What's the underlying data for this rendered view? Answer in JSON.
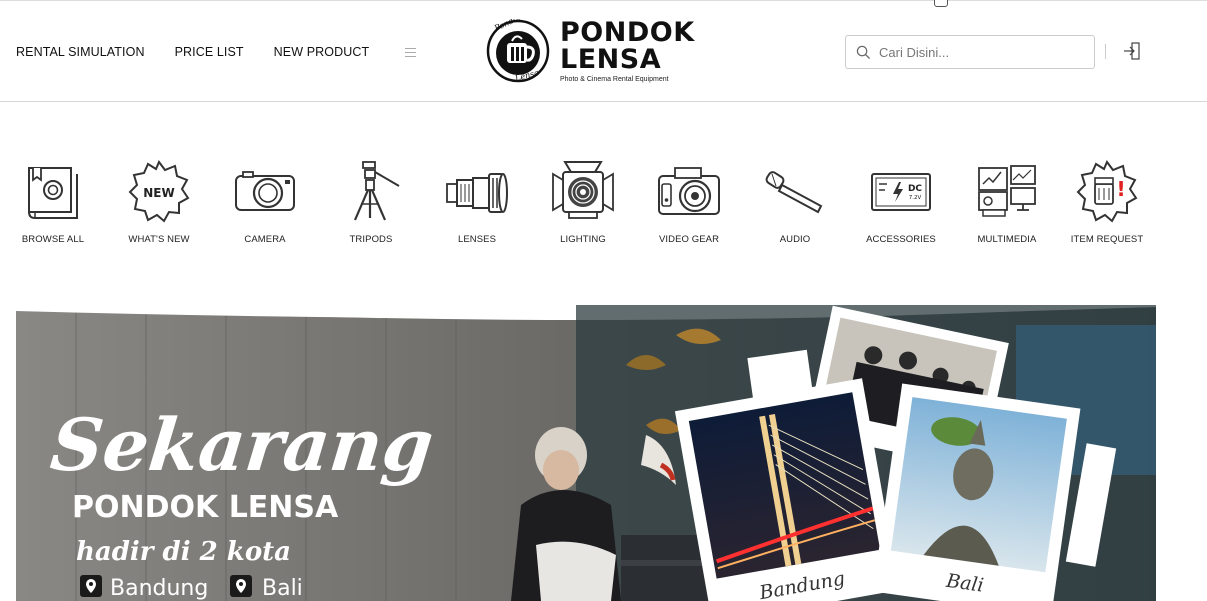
{
  "nav": {
    "items": [
      "RENTAL SIMULATION",
      "PRICE LIST",
      "NEW PRODUCT"
    ]
  },
  "logo": {
    "badge_script_top": "Pondok",
    "badge_script_bottom": "Lensa",
    "line1": "PONDOK",
    "line2": "LENSA",
    "tagline": "Photo & Cinema Rental Equipment"
  },
  "search": {
    "placeholder": "Cari Disini..."
  },
  "categories": [
    {
      "label": "BROWSE ALL",
      "icon": "book-icon"
    },
    {
      "label": "WHAT'S NEW",
      "icon": "new-badge-icon",
      "badge_text": "NEW"
    },
    {
      "label": "CAMERA",
      "icon": "camera-icon"
    },
    {
      "label": "TRIPODS",
      "icon": "tripod-icon"
    },
    {
      "label": "LENSES",
      "icon": "lens-icon"
    },
    {
      "label": "LIGHTING",
      "icon": "spotlight-icon"
    },
    {
      "label": "VIDEO GEAR",
      "icon": "video-camera-icon"
    },
    {
      "label": "AUDIO",
      "icon": "microphone-icon"
    },
    {
      "label": "ACCESSORIES",
      "icon": "battery-icon",
      "badge_text": "DC",
      "badge_sub": "7.2V"
    },
    {
      "label": "MULTIMEDIA",
      "icon": "multimedia-icon"
    },
    {
      "label": "ITEM REQUEST",
      "icon": "request-badge-icon",
      "badge_text": "!"
    }
  ],
  "banner": {
    "headline": "Sekarang",
    "brand": "PONDOK LENSA",
    "subline": "hadir di 2 kota",
    "cities": [
      "Bandung",
      "Bali"
    ],
    "photo_captions": [
      "Bandung",
      "Bali"
    ]
  },
  "colors": {
    "text": "#111111",
    "border": "#cccccc",
    "accent_red": "#e02020"
  }
}
